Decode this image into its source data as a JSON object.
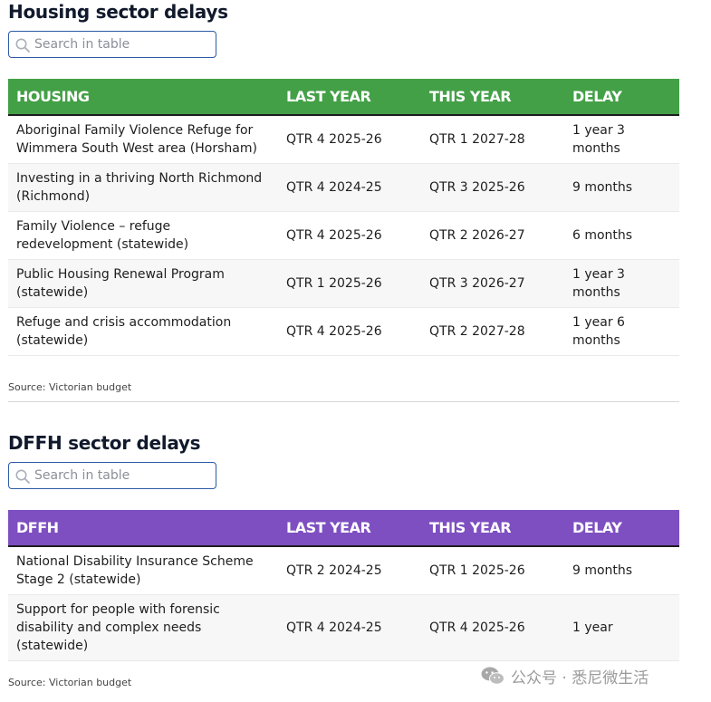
{
  "housing": {
    "title": "Housing sector delays",
    "search_placeholder": "Search in table",
    "header_color": "#43a047",
    "columns": [
      "HOUSING",
      "LAST YEAR",
      "THIS YEAR",
      "DELAY"
    ],
    "rows": [
      [
        "Aboriginal Family Violence Refuge for Wimmera South West area (Horsham)",
        "QTR 4 2025-26",
        "QTR 1 2027-28",
        "1 year 3 months"
      ],
      [
        "Investing in a thriving North Richmond (Richmond)",
        "QTR 4 2024-25",
        "QTR 3 2025-26",
        "9 months"
      ],
      [
        "Family Violence – refuge redevelopment (statewide)",
        "QTR 4 2025-26",
        "QTR 2 2026-27",
        "6 months"
      ],
      [
        "Public Housing Renewal Program (statewide)",
        "QTR 1 2025-26",
        "QTR 3 2026-27",
        "1 year 3 months"
      ],
      [
        "Refuge and crisis accommodation (statewide)",
        "QTR 4 2025-26",
        "QTR 2 2027-28",
        "1 year 6 months"
      ]
    ],
    "source": "Source: Victorian budget"
  },
  "dffh": {
    "title": "DFFH sector delays",
    "search_placeholder": "Search in table",
    "header_color": "#7e4fc1",
    "columns": [
      "DFFH",
      "LAST YEAR",
      "THIS YEAR",
      "DELAY"
    ],
    "rows": [
      [
        "National Disability Insurance Scheme Stage 2 (statewide)",
        "QTR 2 2024-25",
        "QTR 1 2025-26",
        "9 months"
      ],
      [
        "Support for people with forensic disability and complex needs (statewide)",
        "QTR 4 2024-25",
        "QTR 4 2025-26",
        "1 year"
      ]
    ],
    "source": "Source: Victorian budget"
  },
  "watermark": {
    "text": "公众号 · 悉尼微生活",
    "icon": "wechat-icon"
  }
}
